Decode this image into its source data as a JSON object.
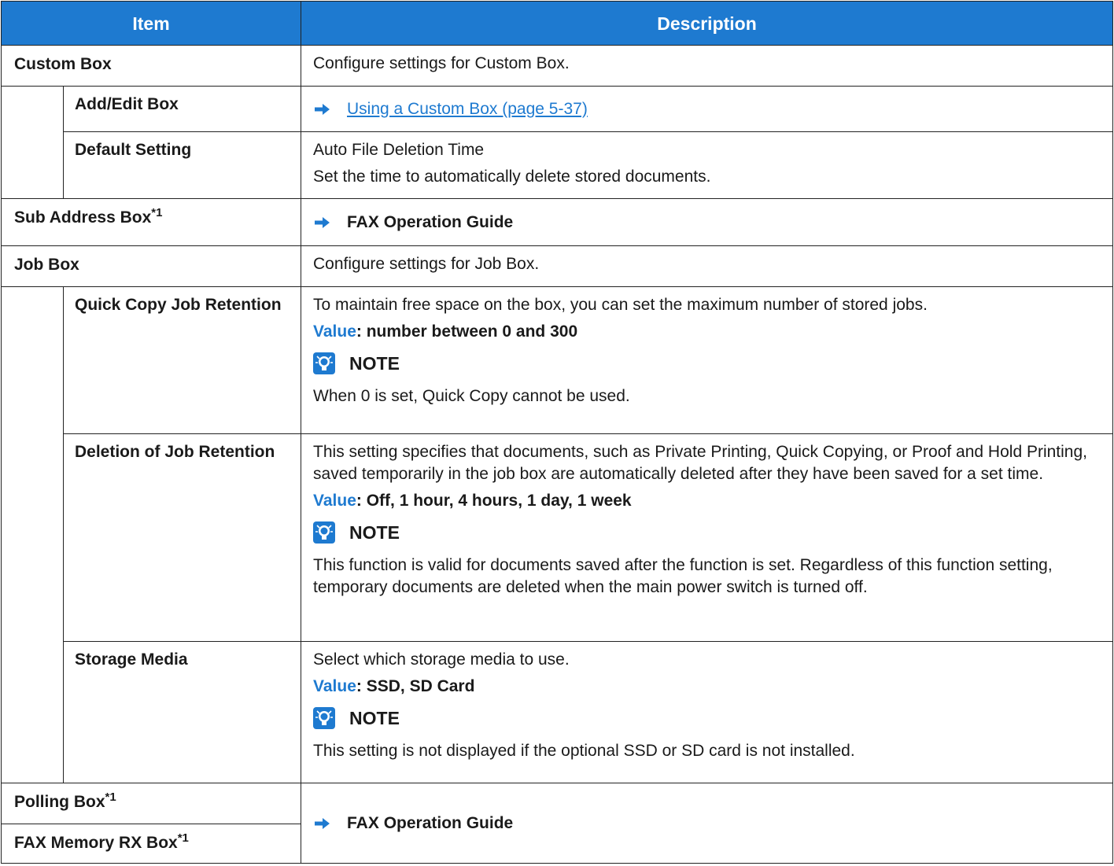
{
  "header": {
    "item": "Item",
    "description": "Description"
  },
  "colors": {
    "header_bg": "#1e7ad0",
    "accent": "#1e7ad0"
  },
  "rows": {
    "custom_box": {
      "label": "Custom Box",
      "desc": "Configure settings for Custom Box."
    },
    "add_edit_box": {
      "label": "Add/Edit Box",
      "link": "Using a Custom Box (page 5-37)"
    },
    "default_setting": {
      "label": "Default Setting",
      "line1": "Auto File Deletion Time",
      "line2": "Set the time to automatically delete stored documents."
    },
    "sub_address_box": {
      "label": "Sub Address Box",
      "sup": "*1",
      "ref": "FAX Operation Guide"
    },
    "job_box": {
      "label": "Job Box",
      "desc": "Configure settings for Job Box."
    },
    "quick_copy": {
      "label": "Quick Copy Job Retention",
      "desc": "To maintain free space on the box, you can set the maximum number of stored jobs.",
      "value_label": "Value",
      "value_text": ": number between 0 and 300",
      "note_title": "NOTE",
      "note_text": "When 0 is set, Quick Copy cannot be used."
    },
    "deletion": {
      "label": "Deletion of Job Retention",
      "desc": "This setting specifies that documents, such as Private Printing, Quick Copying, or Proof and Hold Printing, saved temporarily in the job box are automatically deleted after they have been saved for a set time.",
      "value_label": "Value",
      "value_text": ": Off, 1 hour, 4 hours, 1 day, 1 week",
      "note_title": "NOTE",
      "note_text": "This function is valid for documents saved after the function is set. Regardless of this function setting, temporary documents are deleted when the main power switch is turned off."
    },
    "storage_media": {
      "label": "Storage Media",
      "desc": "Select which storage media to use.",
      "value_label": "Value",
      "value_text": ": SSD, SD Card",
      "note_title": "NOTE",
      "note_text": "This setting is not displayed if the optional SSD or SD card is not installed."
    },
    "polling_box": {
      "label": "Polling Box",
      "sup": "*1"
    },
    "fax_memory_rx_box": {
      "label": "FAX Memory RX Box",
      "sup": "*1"
    },
    "fax_ref": {
      "ref": "FAX Operation Guide"
    }
  },
  "icons": {
    "arrow": "right-arrow-icon",
    "note": "note-lightbulb-icon"
  }
}
